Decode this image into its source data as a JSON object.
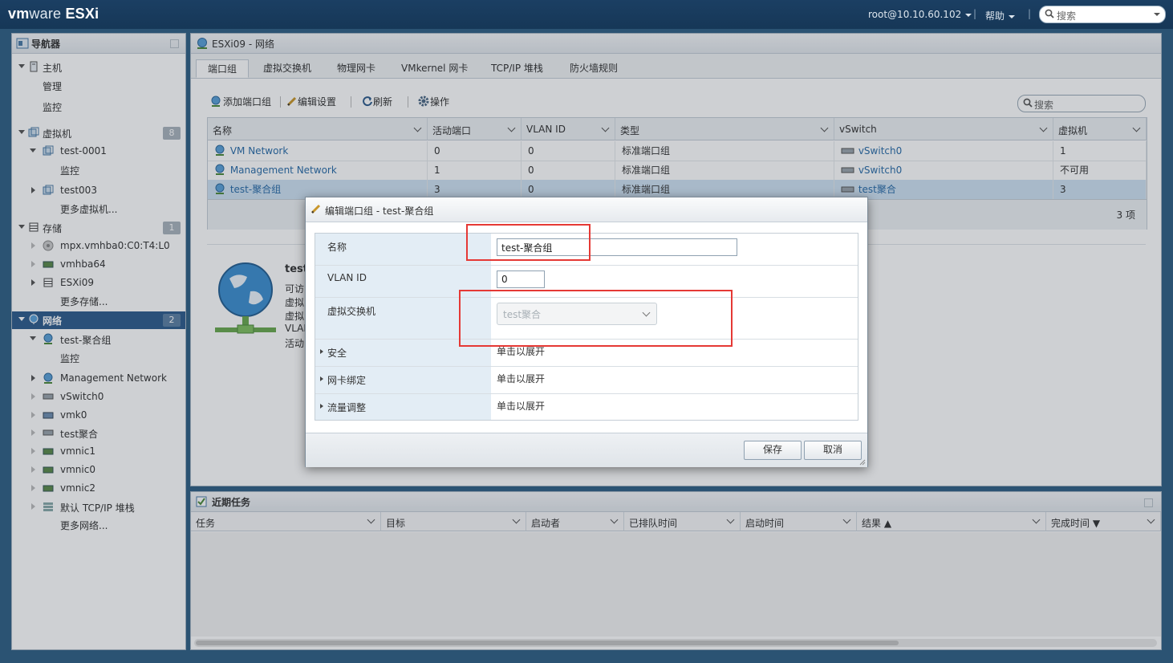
{
  "header": {
    "logo_vm": "vm",
    "logo_ware": "ware",
    "logo_esxi": " ESXi",
    "user": "root@10.10.60.102",
    "help": "帮助",
    "search_placeholder": "搜索",
    "separator": "|"
  },
  "navigator": {
    "title": "导航器",
    "items": [
      {
        "label": "主机"
      },
      {
        "label": "管理"
      },
      {
        "label": "监控"
      },
      {
        "label": "虚拟机",
        "badge": "8"
      },
      {
        "label": "test-0001"
      },
      {
        "label": "监控"
      },
      {
        "label": "test003"
      },
      {
        "label": "更多虚拟机..."
      },
      {
        "label": "存储",
        "badge": "1"
      },
      {
        "label": "mpx.vmhba0:C0:T4:L0"
      },
      {
        "label": "vmhba64"
      },
      {
        "label": "ESXi09"
      },
      {
        "label": "更多存储..."
      },
      {
        "label": "网络",
        "badge": "2"
      },
      {
        "label": "test-聚合组"
      },
      {
        "label": "监控"
      },
      {
        "label": "Management Network"
      },
      {
        "label": "vSwitch0"
      },
      {
        "label": "vmk0"
      },
      {
        "label": "test聚合"
      },
      {
        "label": "vmnic1"
      },
      {
        "label": "vmnic0"
      },
      {
        "label": "vmnic2"
      },
      {
        "label": "默认 TCP/IP 堆栈"
      },
      {
        "label": "更多网络..."
      }
    ]
  },
  "main": {
    "title": "ESXi09 - 网络",
    "tabs": [
      "端口组",
      "虚拟交换机",
      "物理网卡",
      "VMkernel 网卡",
      "TCP/IP 堆栈",
      "防火墙规则"
    ],
    "toolbar": {
      "add": "添加端口组",
      "edit": "编辑设置",
      "refresh": "刷新",
      "actions": "操作",
      "search_placeholder": "搜索"
    },
    "grid": {
      "columns": [
        "名称",
        "活动端口",
        "VLAN ID",
        "类型",
        "vSwitch",
        "虚拟机"
      ],
      "rows": [
        {
          "name": "VM Network",
          "active": "0",
          "vlan": "0",
          "type": "标准端口组",
          "vswitch": "vSwitch0",
          "vms": "1"
        },
        {
          "name": "Management Network",
          "active": "1",
          "vlan": "0",
          "type": "标准端口组",
          "vswitch": "vSwitch0",
          "vms": "不可用"
        },
        {
          "name": "test-聚合组",
          "active": "3",
          "vlan": "0",
          "type": "标准端口组",
          "vswitch": "test聚合",
          "vms": "3"
        }
      ],
      "count": "3 项"
    },
    "preview": {
      "title": "test",
      "lines": [
        "可访",
        "虚拟",
        "虚拟",
        "VLAI",
        "活动"
      ]
    }
  },
  "tasks": {
    "title": "近期任务",
    "columns": [
      "任务",
      "目标",
      "启动者",
      "已排队时间",
      "启动时间",
      "结果 ▲",
      "完成时间 ▼"
    ]
  },
  "dialog": {
    "title": "编辑端口组 - test-聚合组",
    "fields": {
      "name_label": "名称",
      "name_value": "test-聚合组",
      "vlan_label": "VLAN ID",
      "vlan_value": "0",
      "vswitch_label": "虚拟交换机",
      "vswitch_value": "test聚合",
      "security_label": "安全",
      "security_value": "单击以展开",
      "teaming_label": "网卡绑定",
      "teaming_value": "单击以展开",
      "shaping_label": "流量调整",
      "shaping_value": "单击以展开"
    },
    "save": "保存",
    "cancel": "取消"
  },
  "colors": {
    "accent": "#2d5b8c",
    "highlight_box": "#e53935",
    "selected_row": "#cfe2f3"
  }
}
